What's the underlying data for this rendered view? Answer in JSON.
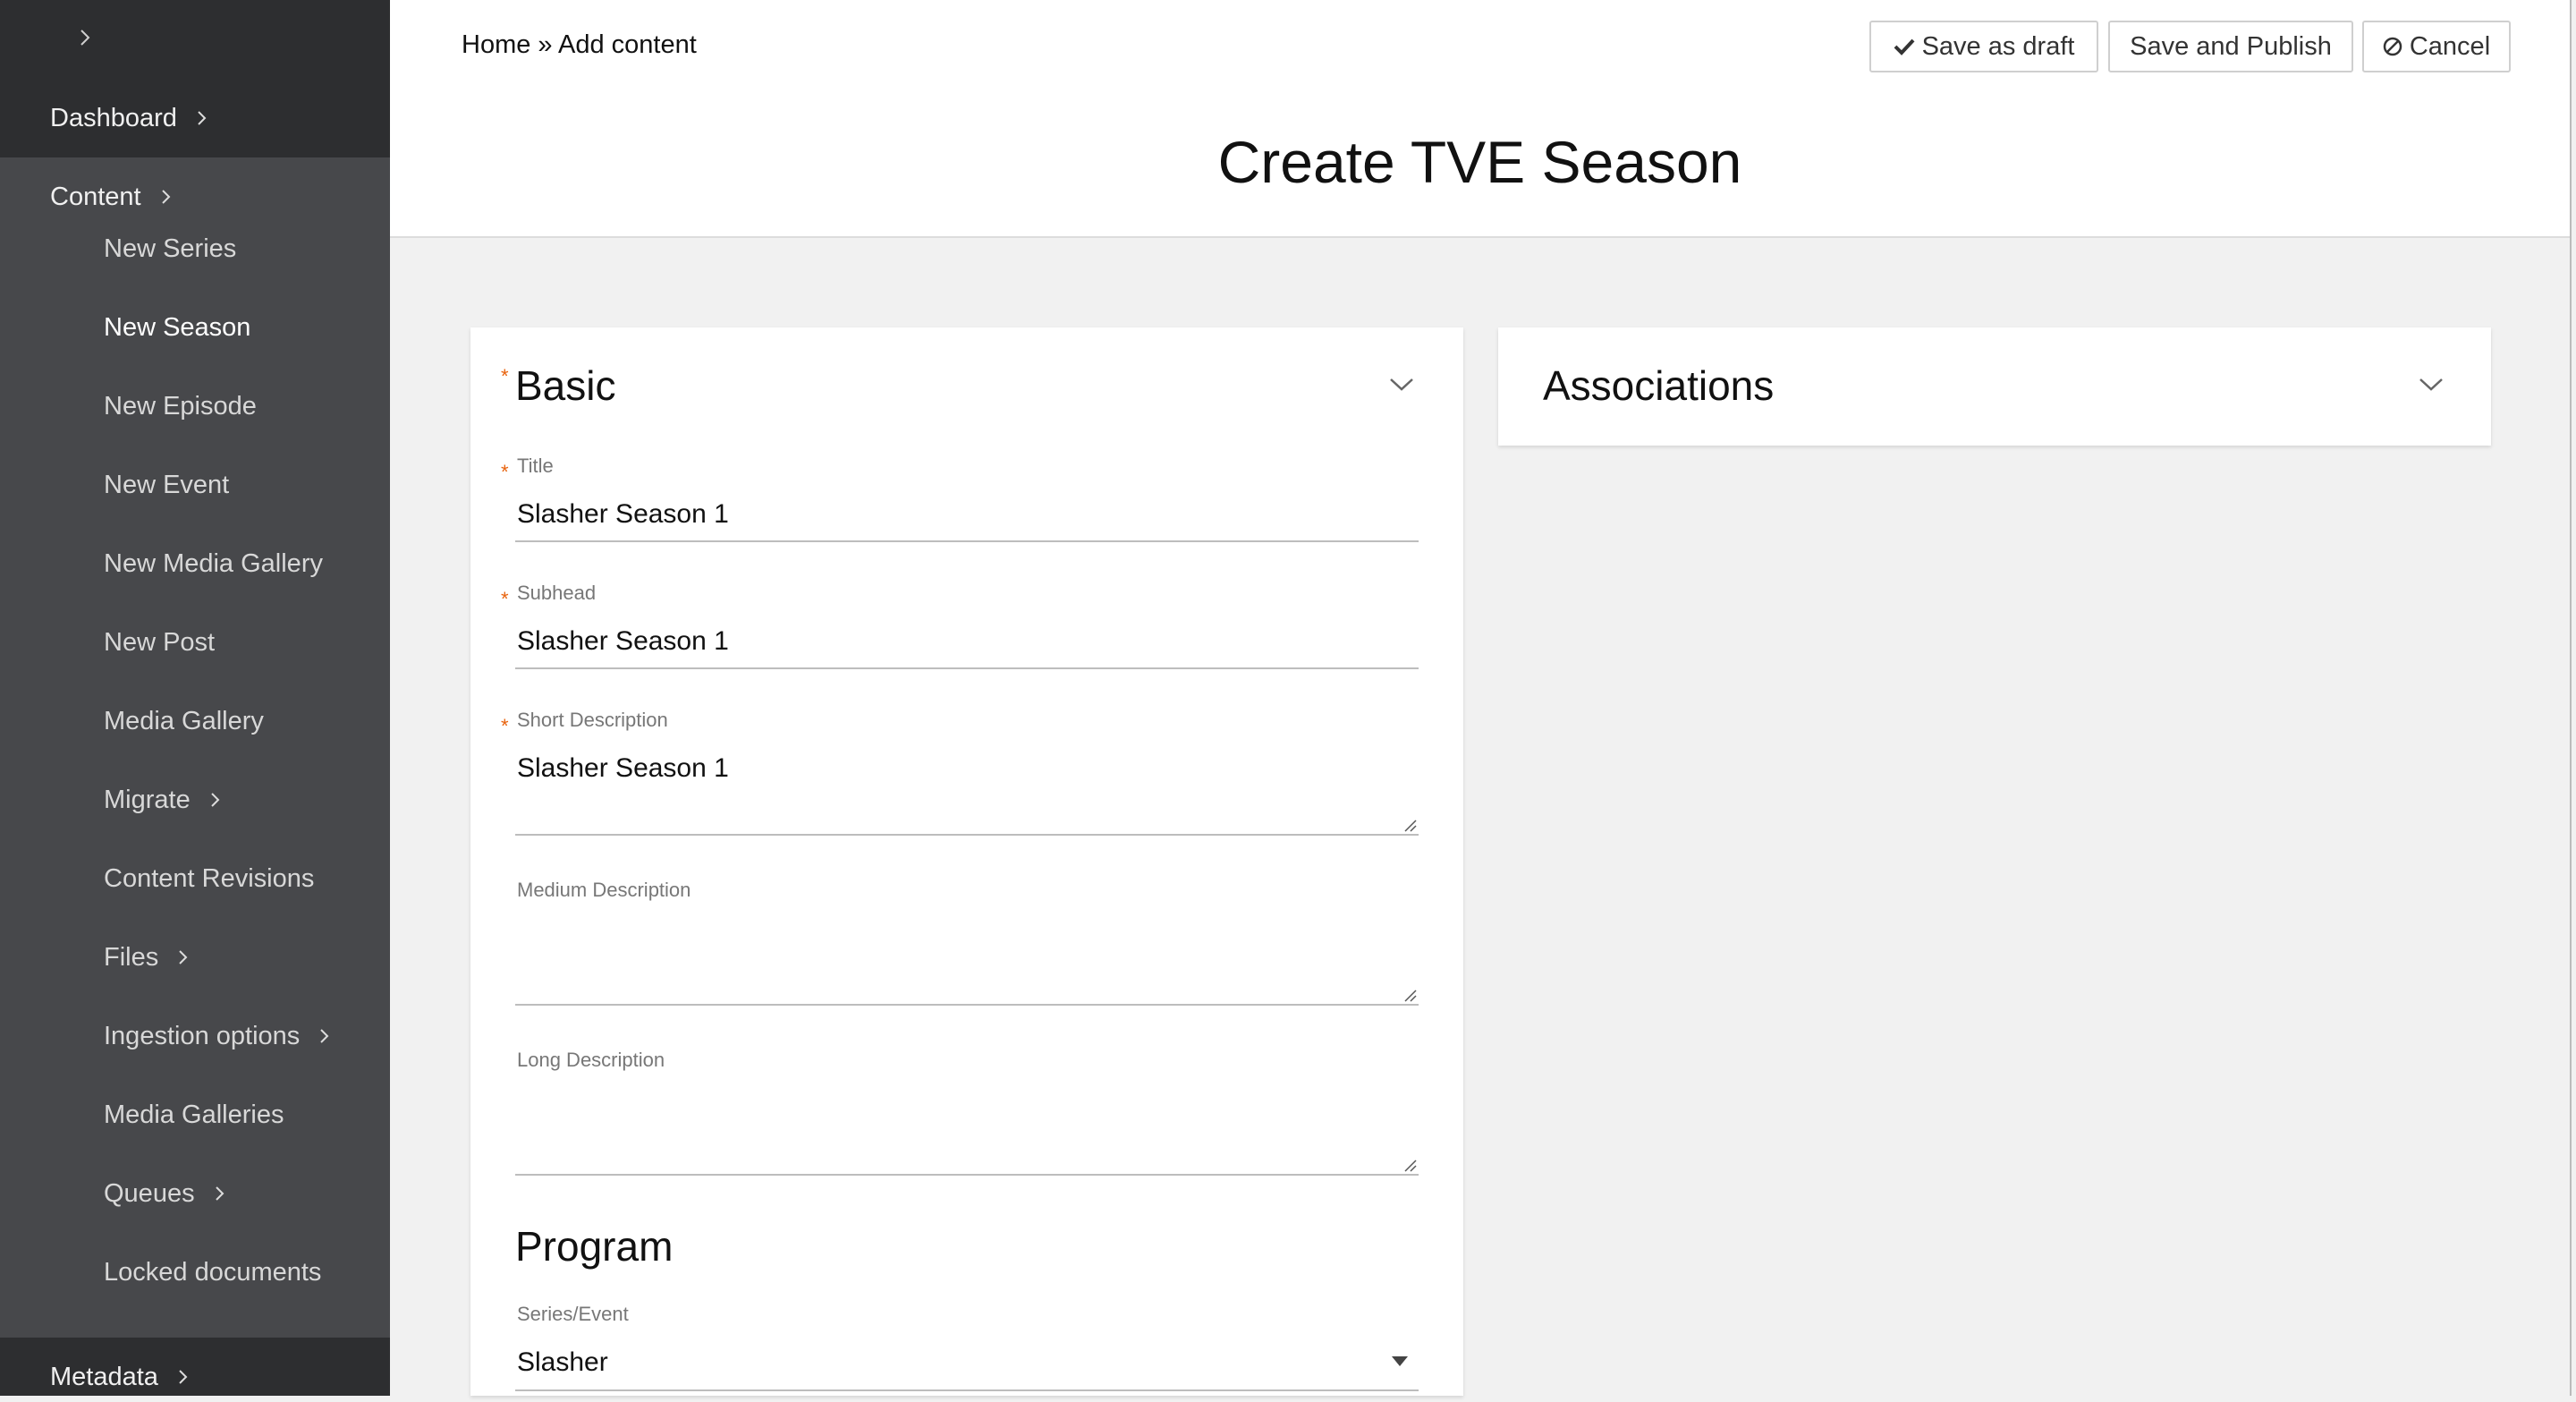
{
  "sidebar": {
    "top_items": [
      {
        "label": "Dashboard"
      },
      {
        "label": "Content"
      },
      {
        "label": "Metadata"
      }
    ],
    "content_items": [
      {
        "label": "New Series"
      },
      {
        "label": "New Season"
      },
      {
        "label": "New Episode"
      },
      {
        "label": "New Event"
      },
      {
        "label": "New Media Gallery"
      },
      {
        "label": "New Post"
      },
      {
        "label": "Media Gallery"
      },
      {
        "label": "Migrate"
      },
      {
        "label": "Content Revisions"
      },
      {
        "label": "Files"
      },
      {
        "label": "Ingestion options"
      },
      {
        "label": "Media Galleries"
      },
      {
        "label": "Queues"
      },
      {
        "label": "Locked documents"
      }
    ],
    "active_item": "New Season"
  },
  "header": {
    "breadcrumb": "Home » Add content",
    "buttons": {
      "save_draft": "Save as draft",
      "save_publish": "Save and Publish",
      "cancel": "Cancel"
    },
    "page_title": "Create TVE Season"
  },
  "basic": {
    "title": "Basic",
    "fields": {
      "title": {
        "label": "Title",
        "value": "Slasher Season 1"
      },
      "subhead": {
        "label": "Subhead",
        "value": "Slasher Season 1"
      },
      "short_description": {
        "label": "Short Description",
        "value": "Slasher Season 1"
      },
      "medium_description": {
        "label": "Medium Description",
        "value": ""
      },
      "long_description": {
        "label": "Long Description",
        "value": ""
      }
    },
    "program": {
      "title": "Program",
      "series_event": {
        "label": "Series/Event",
        "value": "Slasher"
      }
    }
  },
  "associations": {
    "title": "Associations"
  },
  "colors": {
    "sidebar_bg": "#47484b",
    "sidebar_top_bg": "#2d2e30",
    "required_star": "#e8620c",
    "page_bg": "#f1f1f1"
  }
}
